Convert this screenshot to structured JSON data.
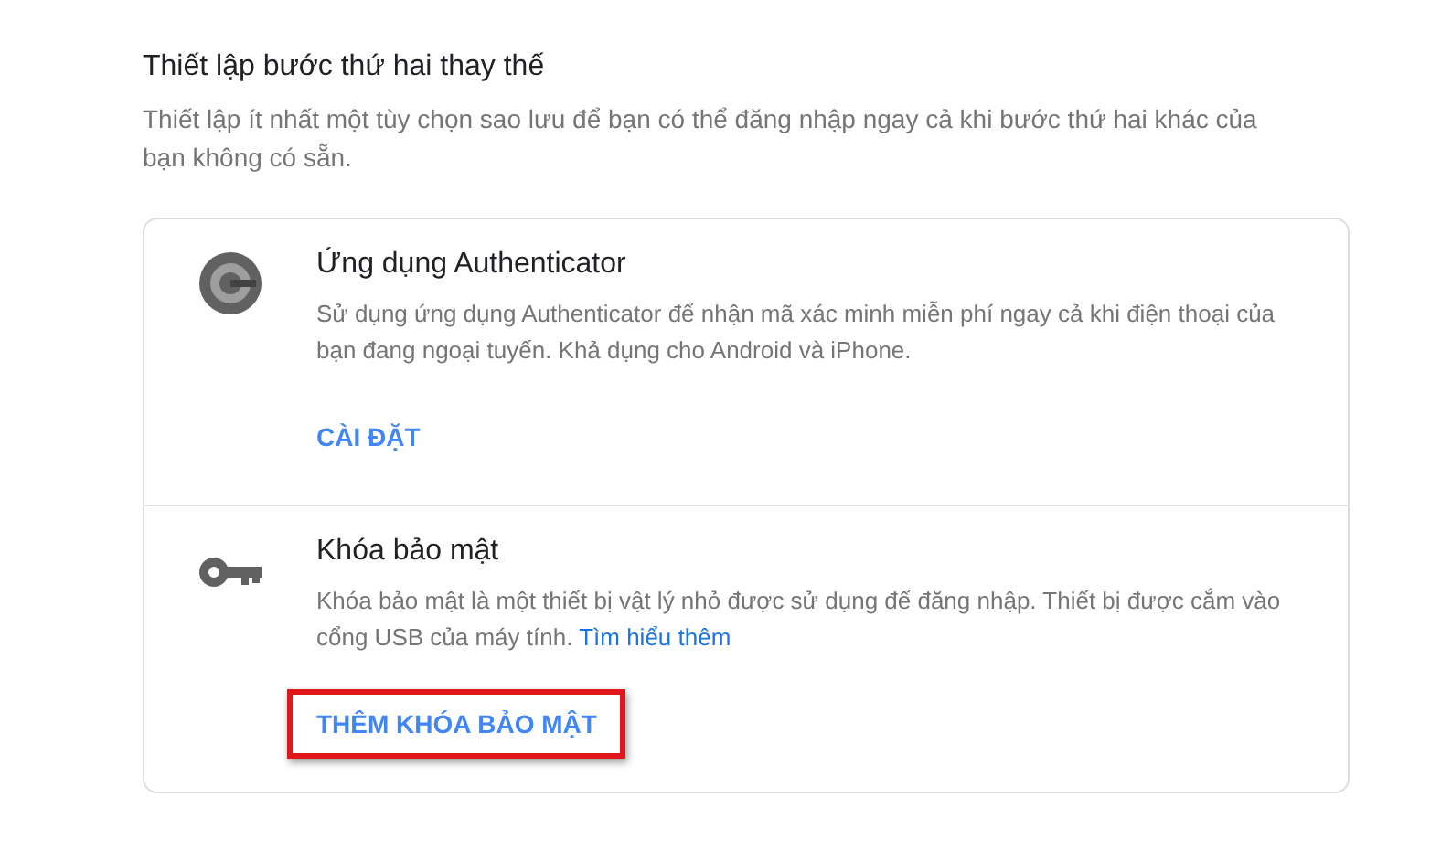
{
  "section": {
    "title": "Thiết lập bước thứ hai thay thế",
    "description": "Thiết lập ít nhất một tùy chọn sao lưu để bạn có thể đăng nhập ngay cả khi bước thứ hai khác của bạn không có sẵn."
  },
  "options": [
    {
      "kind": "authenticator",
      "title": "Ứng dụng Authenticator",
      "description": "Sử dụng ứng dụng Authenticator để nhận mã xác minh miễn phí ngay cả khi điện thoại của bạn đang ngoại tuyến. Khả dụng cho Android và iPhone.",
      "button": {
        "label": "CÀI ĐẶT",
        "highlighted": false
      }
    },
    {
      "kind": "security_key",
      "title": "Khóa bảo mật",
      "description": "Khóa bảo mật là một thiết bị vật lý nhỏ được sử dụng để đăng nhập. Thiết bị được cắm vào cổng USB của máy tính.",
      "link": "Tìm hiểu thêm",
      "button": {
        "label": "THÊM KHÓA BẢO MẬT",
        "highlighted": true
      }
    }
  ]
}
